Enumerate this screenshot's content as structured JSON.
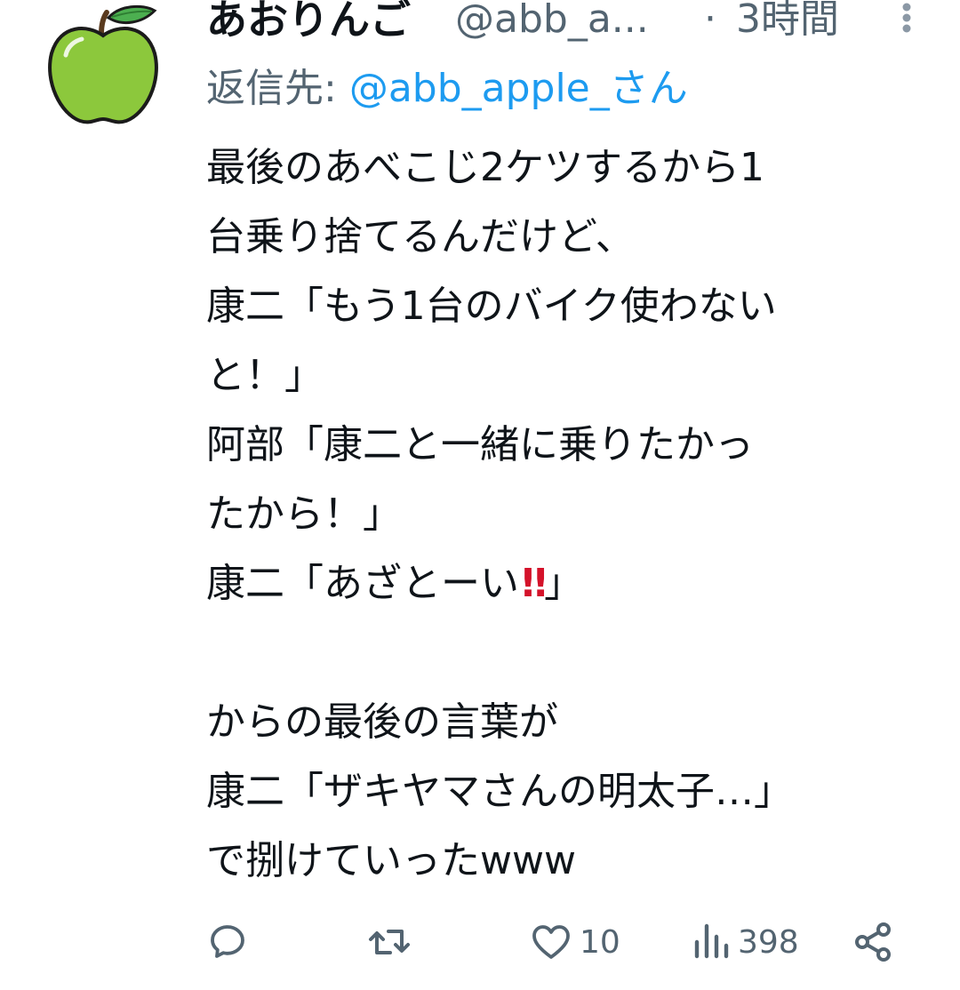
{
  "tweet": {
    "display_name": "あおりんご",
    "handle": "@abb_a...",
    "separator": "·",
    "time": "3時間",
    "reply_prefix": "返信先: ",
    "reply_mention": "@abb_apple_さん",
    "lines": [
      "最後のあべこじ2ケツするから1",
      "台乗り捨てるんだけど、",
      "康二「もう1台のバイク使わない",
      "と！」",
      "阿部「康二と一緒に乗りたかっ",
      "たから！」",
      "",
      "",
      "からの最後の言葉が",
      "康二「ザキヤマさんの明太子…」",
      "で捌けていったwww"
    ],
    "line7_before": "康二「あざとーい",
    "line7_emoji": "!!",
    "line7_after": "」"
  },
  "actions": {
    "reply_count": "",
    "retweet_count": "",
    "like_count": "10",
    "views_count": "398"
  },
  "icons": {
    "avatar": "green-apple-avatar",
    "more": "more-options-icon",
    "reply": "reply-bubble-icon",
    "retweet": "retweet-icon",
    "like": "heart-icon",
    "views": "views-bars-icon",
    "share": "share-icon"
  },
  "colors": {
    "text": "#0f1419",
    "secondary": "#536471",
    "link": "#1d9bf0",
    "apple": "#8cc83c",
    "emoji_red": "#d4122a"
  }
}
